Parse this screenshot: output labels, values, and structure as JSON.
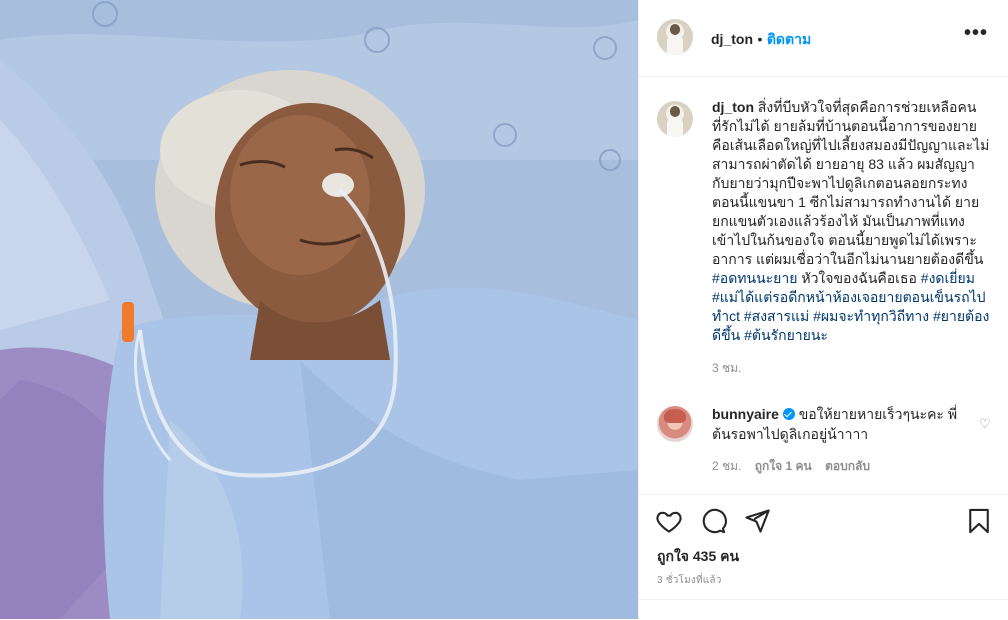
{
  "post": {
    "author": "dj_ton",
    "follow_label": "ติดตาม",
    "separator": "•",
    "more_label": "•••"
  },
  "caption": {
    "username": "dj_ton",
    "text_plain": "สิ่งที่บีบหัวใจที่สุดคือการช่วยเหลือคนที่รักไม่ได้ ยายล้มที่บ้านตอนนี้อาการของยายคือเส้นเลือดใหญ่ที่ไปเลี้ยงสมองมีปัญญาและไม่สามารถผ่าตัดได้ ยายอายุ 83 แล้ว ผมสัญญากับยายว่ามุกปีจะพาไปดูลิเกตอนลอยกระทง ตอนนี้แขนขา 1 ซีกไม่สามารถทำงานได้ ยายยกแขนตัวเองแล้วร้องไห้ มันเป็นภาพที่แทงเข้าไปในก้นของใจ ตอนนี้ยายพูดไม่ได้เพราะอาการ แต่ผมเชื่อว่าในอีกไม่นานยายต้องดีขึ้น",
    "hashtag_1": "#อดทนนะยาย",
    "text_after": "หัวใจของฉันคือเธอ",
    "hashtags_rest": "#งดเยี่ยม #แม่ได้แต่รอดีกหน้าห้องเจอยายตอนเข็นรถไปทำct #สงสารแม่ #ผมจะทำทุกวิถีทาง #ยายต้องดีขึ้น #ต้นรักยายนะ",
    "age": "3 ชม."
  },
  "comment": {
    "username": "bunnyaire",
    "text": "ขอให้ยายหายเร็วๆนะคะ พี่ต้นรอพาไปดูลิเกอยู่น้าาาา",
    "age": "2 ชม.",
    "likes": "ถูกใจ 1 คน",
    "reply": "ตอบกลับ",
    "heart_icon": "♡"
  },
  "footer": {
    "likes_text": "ถูกใจ 435 คน",
    "timestamp": "3 ชั่วโมงที่แล้ว"
  },
  "icons": {
    "like": "heart-outline-icon",
    "comment": "comment-bubble-icon",
    "share": "paper-plane-icon",
    "save": "bookmark-icon"
  },
  "colors": {
    "link": "#0095f6",
    "hashtag": "#00376b",
    "muted": "#8e8e8e",
    "text": "#262626"
  }
}
